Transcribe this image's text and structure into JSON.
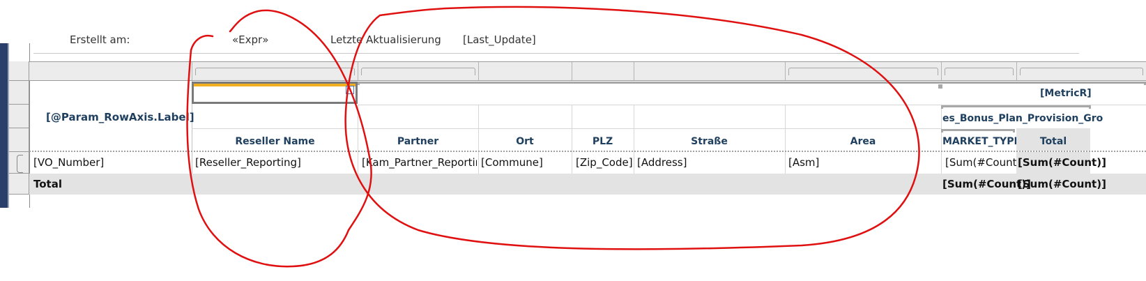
{
  "header": {
    "created_label": "Erstellt am:",
    "created_value": "«Expr»",
    "updated_label": "Letzte Aktualisierung",
    "updated_value": "[Last_Update]"
  },
  "matrix": {
    "row_axis_label": "[@Param_RowAxis.Label]",
    "metric_label": "[MetricR]",
    "group_header": "es_Bonus_Plan_Provision_Gro",
    "columns": [
      "Reseller Name",
      "Partner",
      "Ort",
      "PLZ",
      "Straße",
      "Area"
    ],
    "market_type_header": "MARKET_TYPE",
    "total_header": "Total",
    "detail_row": {
      "vo_number": "[VO_Number]",
      "reseller": "[Reseller_Reporting]",
      "partner": "[Kam_Partner_Reporting",
      "ort": "[Commune]",
      "plz": "[Zip_Code]",
      "strasse": "[Address]",
      "area": "[Asm]",
      "market_sum": "[Sum(#Count)]",
      "total_sum": "[Sum(#Count)]"
    },
    "total_row": {
      "label": "Total",
      "market_sum": "[Sum(#Count)]",
      "total_sum": "[Sum(#Count)]"
    }
  },
  "colors": {
    "annotation": "#e01010",
    "selection_top": "#f0b020",
    "label_text": "#1f3f5f",
    "designer_bar": "#2a3f6a"
  }
}
